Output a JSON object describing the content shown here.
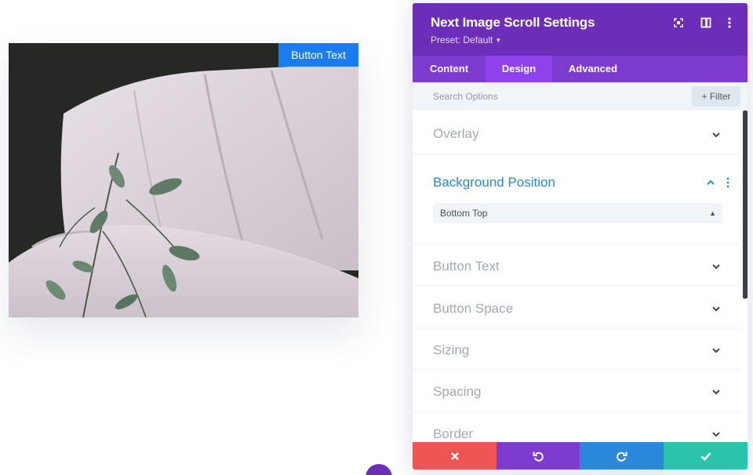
{
  "preview": {
    "button_label": "Button Text"
  },
  "modal": {
    "title": "Next Image Scroll Settings",
    "preset": "Preset: Default",
    "header_icons": [
      "fullscreen-icon",
      "split-view-icon",
      "more-vertical-icon"
    ]
  },
  "tabs": [
    {
      "label": "Content",
      "active": false
    },
    {
      "label": "Design",
      "active": true
    },
    {
      "label": "Advanced",
      "active": false
    }
  ],
  "search": {
    "placeholder": "Search Options",
    "filter_label": "+ Filter"
  },
  "sections": [
    {
      "label": "Overlay",
      "open": false
    },
    {
      "label": "Background Position",
      "open": true,
      "select_value": "Bottom Top"
    },
    {
      "label": "Button Text",
      "open": false
    },
    {
      "label": "Button Space",
      "open": false
    },
    {
      "label": "Sizing",
      "open": false
    },
    {
      "label": "Spacing",
      "open": false
    },
    {
      "label": "Border",
      "open": false
    }
  ],
  "footer": {
    "buttons": [
      {
        "name": "cancel",
        "icon": "close-icon",
        "color": "#ef5555"
      },
      {
        "name": "undo",
        "icon": "undo-icon",
        "color": "#7e3bd0"
      },
      {
        "name": "redo",
        "icon": "redo-icon",
        "color": "#2b87da"
      },
      {
        "name": "save",
        "icon": "check-icon",
        "color": "#29c4a9"
      }
    ]
  },
  "colors": {
    "header": "#6c2eb9",
    "tabs": "#7e3bd0",
    "active_tab": "#8f42ec",
    "accent_blue": "#2b87da",
    "preview_button": "#1a7cf0"
  }
}
